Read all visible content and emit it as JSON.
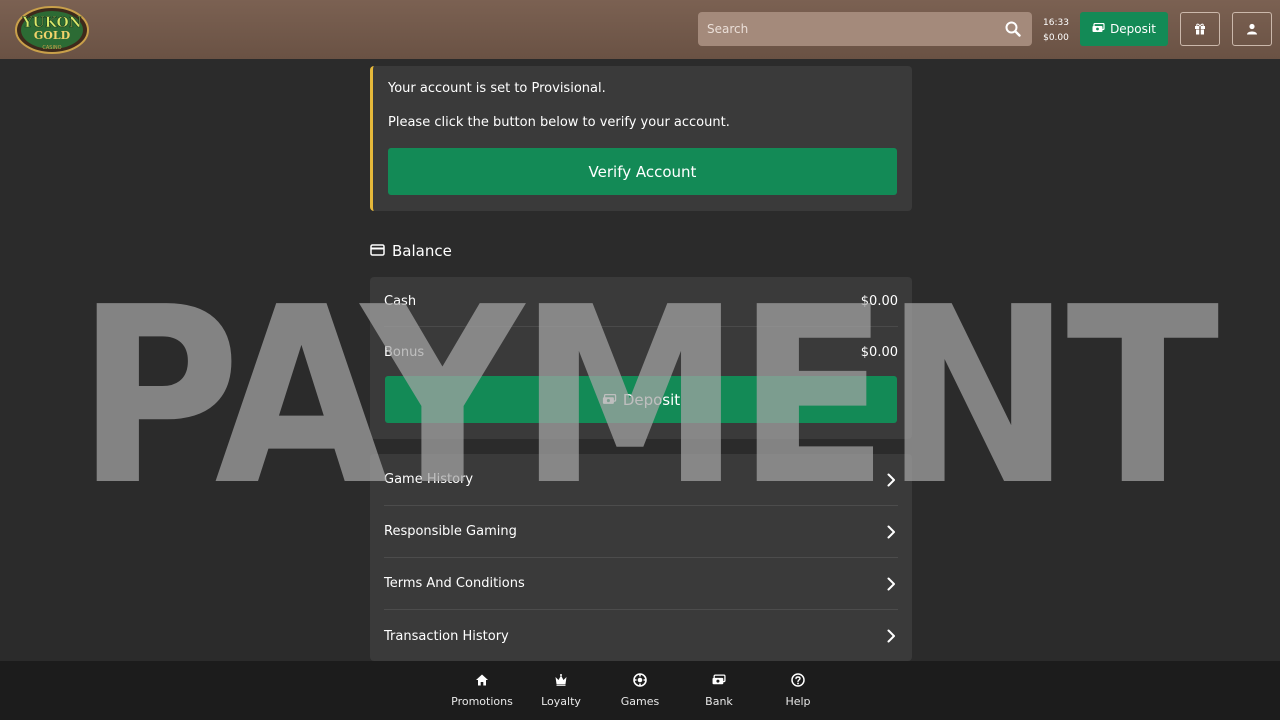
{
  "header": {
    "logo_text": "YUKON GOLD CASINO",
    "search": {
      "placeholder": "Search"
    },
    "clock": {
      "time": "16:33",
      "balance": "$0.00"
    },
    "deposit_label": "Deposit"
  },
  "notice": {
    "line1": "Your account is set to Provisional.",
    "line2": "Please click the button below to verify your account.",
    "button_label": "Verify Account",
    "accent_color": "#e5b83a"
  },
  "balance": {
    "title": "Balance",
    "rows": [
      {
        "label": "Cash",
        "value": "$0.00"
      },
      {
        "label": "Bonus",
        "value": "$0.00"
      }
    ],
    "deposit_label": "Deposit"
  },
  "menu": {
    "items": [
      {
        "label": "Game History"
      },
      {
        "label": "Responsible Gaming"
      },
      {
        "label": "Terms And Conditions"
      },
      {
        "label": "Transaction History"
      }
    ]
  },
  "watermark": "PAYMENT",
  "bottom_nav": {
    "items": [
      {
        "label": "Promotions",
        "icon": "home-icon"
      },
      {
        "label": "Loyalty",
        "icon": "crown-icon"
      },
      {
        "label": "Games",
        "icon": "chip-icon"
      },
      {
        "label": "Bank",
        "icon": "cash-icon"
      },
      {
        "label": "Help",
        "icon": "help-icon"
      }
    ]
  },
  "colors": {
    "header_bg": "#7b6152",
    "search_bg": "#a48a7b",
    "accent_green": "#138a56",
    "page_bg": "#2b2b2b",
    "card_bg": "#3a3a3a",
    "nav_bg": "#1c1c1c"
  }
}
